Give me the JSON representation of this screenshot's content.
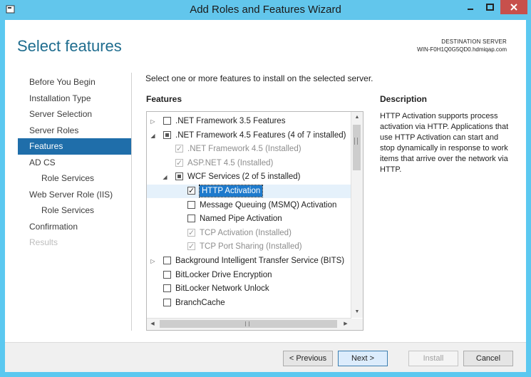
{
  "window": {
    "title": "Add Roles and Features Wizard",
    "controls": {
      "minimize": "minimize",
      "maximize": "maximize",
      "close": "close"
    }
  },
  "header": {
    "page_title": "Select features",
    "destination_label": "DESTINATION SERVER",
    "destination_server": "WIN-F0H1Q0G5QD0.hdmiqap.com"
  },
  "sidebar": {
    "items": [
      {
        "label": "Before You Begin",
        "state": "normal"
      },
      {
        "label": "Installation Type",
        "state": "normal"
      },
      {
        "label": "Server Selection",
        "state": "normal"
      },
      {
        "label": "Server Roles",
        "state": "normal"
      },
      {
        "label": "Features",
        "state": "active"
      },
      {
        "label": "AD CS",
        "state": "normal"
      },
      {
        "label": "Role Services",
        "state": "normal"
      },
      {
        "label": "Web Server Role (IIS)",
        "state": "normal"
      },
      {
        "label": "Role Services",
        "state": "normal"
      },
      {
        "label": "Confirmation",
        "state": "normal"
      },
      {
        "label": "Results",
        "state": "disabled"
      }
    ]
  },
  "main": {
    "instruction": "Select one or more features to install on the selected server.",
    "features_heading": "Features",
    "features": [
      {
        "label": ".NET Framework 3.5 Features",
        "level": 0,
        "expander": "collapsed",
        "check": "unchecked",
        "dim": false
      },
      {
        "label": ".NET Framework 4.5 Features (4 of 7 installed)",
        "level": 0,
        "expander": "expanded",
        "check": "partial",
        "dim": false
      },
      {
        "label": ".NET Framework 4.5 (Installed)",
        "level": 1,
        "expander": "none",
        "check": "checked",
        "dim": true
      },
      {
        "label": "ASP.NET 4.5 (Installed)",
        "level": 1,
        "expander": "none",
        "check": "checked",
        "dim": true
      },
      {
        "label": "WCF Services (2 of 5 installed)",
        "level": 1,
        "expander": "expanded",
        "check": "partial",
        "dim": false
      },
      {
        "label": "HTTP Activation",
        "level": 2,
        "expander": "none",
        "check": "checked",
        "dim": false,
        "selected": true
      },
      {
        "label": "Message Queuing (MSMQ) Activation",
        "level": 2,
        "expander": "none",
        "check": "unchecked",
        "dim": false
      },
      {
        "label": "Named Pipe Activation",
        "level": 2,
        "expander": "none",
        "check": "unchecked",
        "dim": false
      },
      {
        "label": "TCP Activation (Installed)",
        "level": 2,
        "expander": "none",
        "check": "checked",
        "dim": true
      },
      {
        "label": "TCP Port Sharing (Installed)",
        "level": 2,
        "expander": "none",
        "check": "checked",
        "dim": true
      },
      {
        "label": "Background Intelligent Transfer Service (BITS)",
        "level": 0,
        "expander": "collapsed",
        "check": "unchecked",
        "dim": false
      },
      {
        "label": "BitLocker Drive Encryption",
        "level": 0,
        "expander": "none",
        "check": "unchecked",
        "dim": false
      },
      {
        "label": "BitLocker Network Unlock",
        "level": 0,
        "expander": "none",
        "check": "unchecked",
        "dim": false
      },
      {
        "label": "BranchCache",
        "level": 0,
        "expander": "none",
        "check": "unchecked",
        "dim": false
      }
    ],
    "description_heading": "Description",
    "description_text": "HTTP Activation supports process activation via HTTP. Applications that use HTTP Activation can start and stop dynamically in response to work items that arrive over the network via HTTP."
  },
  "footer": {
    "previous_label": "< Previous",
    "next_label": "Next >",
    "install_label": "Install",
    "cancel_label": "Cancel"
  },
  "colors": {
    "titlebar": "#62c6ec",
    "accent_title": "#1e6c8e",
    "nav_active": "#1f6eaa",
    "selection": "#1e7acc",
    "close": "#c7504c"
  }
}
